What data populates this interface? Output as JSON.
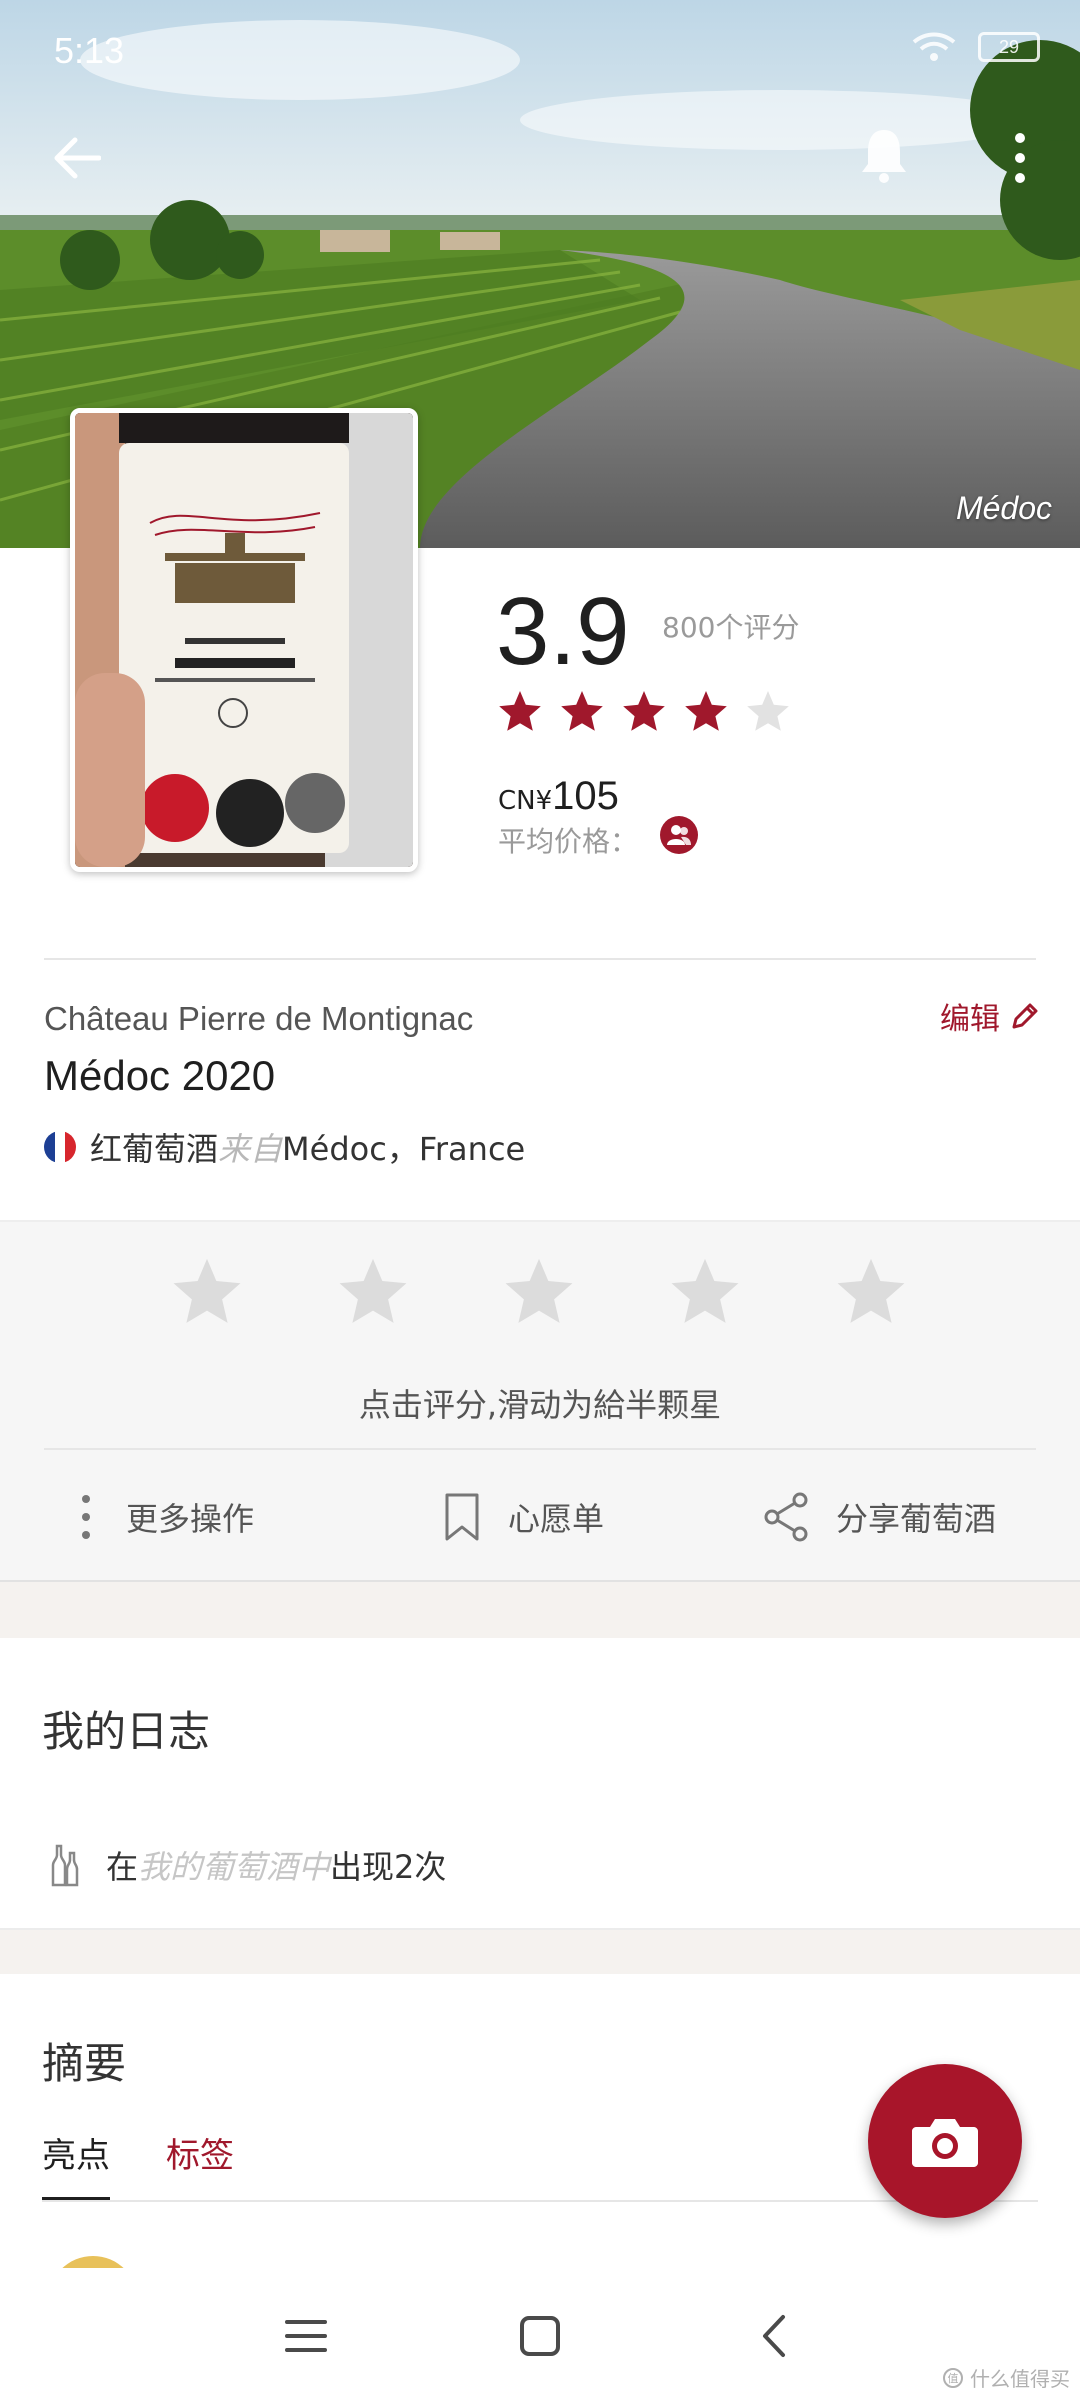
{
  "status_bar": {
    "time": "5:13",
    "battery": "29"
  },
  "hero": {
    "region_label": "Médoc"
  },
  "rating": {
    "score": "3.9",
    "count_text": "800个评分",
    "stars_value": 4,
    "stars_max": 5,
    "star_color": "#a0182c",
    "price_currency": "CN¥",
    "price_amount": "105",
    "avg_price_label": "平均价格："
  },
  "wine": {
    "winery": "Château Pierre de Montignac",
    "name": "Médoc 2020",
    "type": "红葡萄酒",
    "from_word": "来自",
    "region": "Médoc，France",
    "edit_label": "编辑"
  },
  "rate_section": {
    "hint": "点击评分,滑动为給半颗星",
    "actions": [
      {
        "label": "更多操作",
        "icon": "more-vertical-icon"
      },
      {
        "label": "心愿单",
        "icon": "bookmark-icon"
      },
      {
        "label": "分享葡萄酒",
        "icon": "share-icon"
      }
    ]
  },
  "journal": {
    "title": "我的日志",
    "row_prefix": "在",
    "row_link": "我的葡萄酒中",
    "row_suffix": "出现2次"
  },
  "summary": {
    "title": "摘要",
    "tabs": [
      {
        "label": "亮点",
        "active": true
      },
      {
        "label": "标签",
        "active": false
      }
    ]
  },
  "watermark": "什么值得买",
  "colors": {
    "accent": "#a0182c",
    "fab": "#a8152a"
  }
}
